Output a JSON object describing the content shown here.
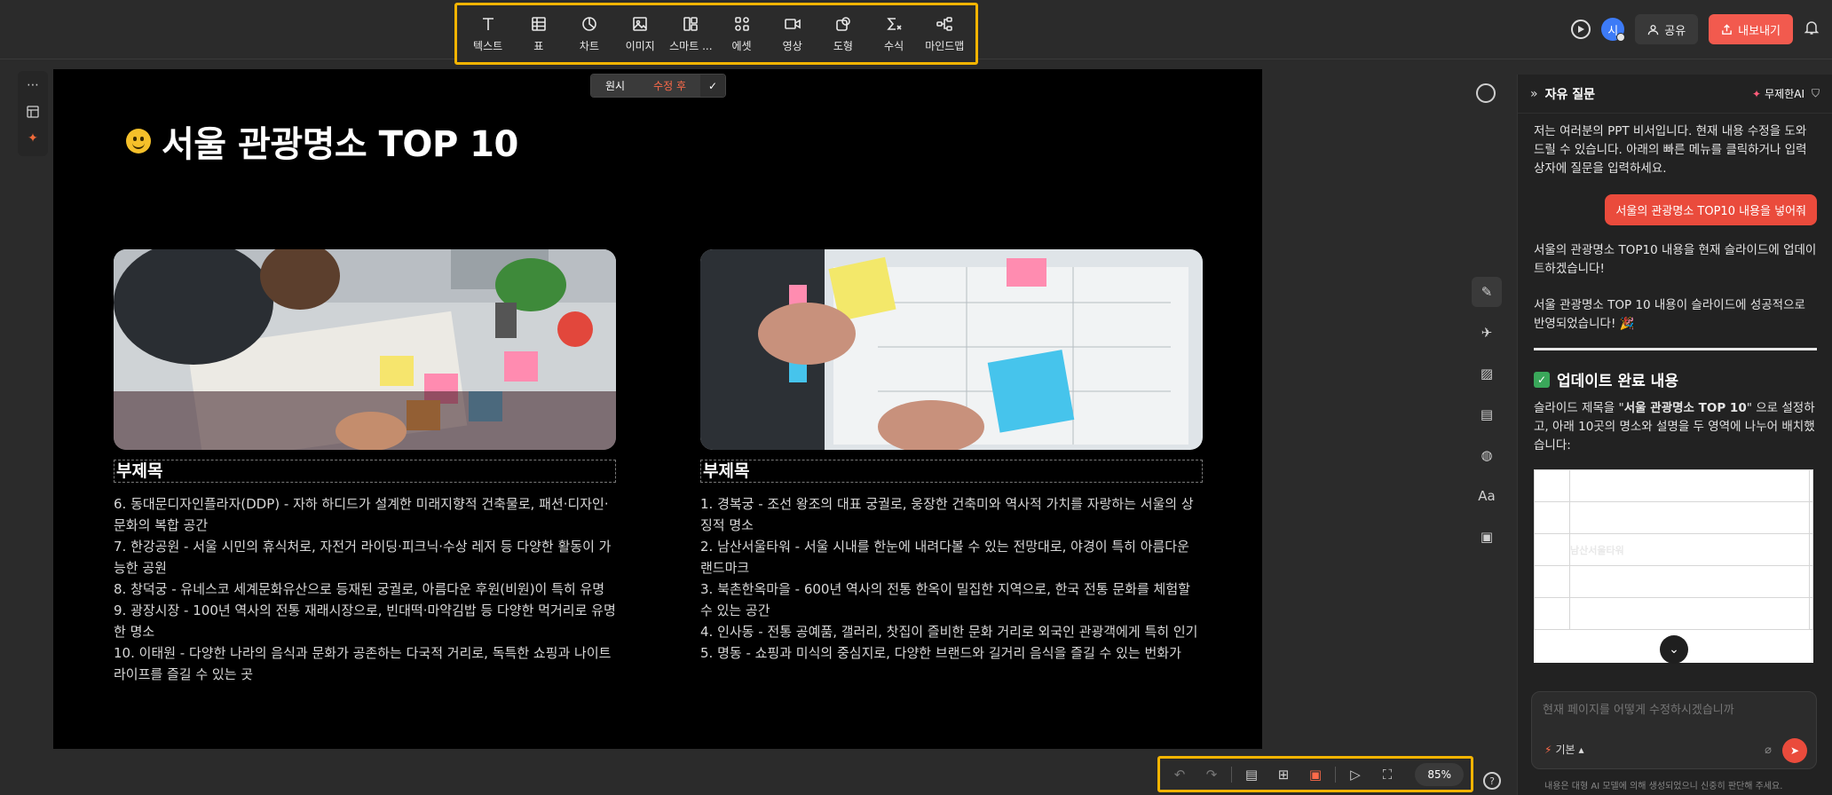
{
  "toolbar": {
    "items": [
      {
        "label": "텍스트",
        "icon": "text-icon"
      },
      {
        "label": "표",
        "icon": "table-icon"
      },
      {
        "label": "차트",
        "icon": "chart-icon"
      },
      {
        "label": "이미지",
        "icon": "image-icon"
      },
      {
        "label": "스마트 ...",
        "icon": "smart-icon"
      },
      {
        "label": "에셋",
        "icon": "asset-icon"
      },
      {
        "label": "영상",
        "icon": "video-icon"
      },
      {
        "label": "도형",
        "icon": "shape-icon"
      },
      {
        "label": "수식",
        "icon": "formula-icon"
      },
      {
        "label": "마인드맵",
        "icon": "mindmap-icon"
      }
    ]
  },
  "header": {
    "avatar_initial": "시",
    "share_label": "공유",
    "export_label": "내보내기"
  },
  "compare": {
    "original": "원시",
    "after": "수정 후",
    "confirm": "✓"
  },
  "slide": {
    "title": "서울 관광명소 TOP 10",
    "left": {
      "subtitle": "부제목",
      "items": [
        "6. 동대문디자인플라자(DDP) - 자하 하디드가 설계한 미래지향적 건축물로, 패션·디자인·문화의 복합 공간",
        "7. 한강공원 - 서울 시민의 휴식처로, 자전거 라이딩·피크닉·수상 레저 등 다양한 활동이 가능한 공원",
        "8. 창덕궁 - 유네스코 세계문화유산으로 등재된 궁궐로, 아름다운 후원(비원)이 특히 유명",
        "9. 광장시장 - 100년 역사의 전통 재래시장으로, 빈대떡·마약김밥 등 다양한 먹거리로 유명한 명소",
        "10. 이태원 - 다양한 나라의 음식과 문화가 공존하는 다국적 거리로, 독특한 쇼핑과 나이트라이프를 즐길 수 있는 곳"
      ]
    },
    "right": {
      "subtitle": "부제목",
      "items": [
        "1. 경복궁 - 조선 왕조의 대표 궁궐로, 웅장한 건축미와 역사적 가치를 자랑하는 서울의 상징적 명소",
        "2. 남산서울타워 - 서울 시내를 한눈에 내려다볼 수 있는 전망대로, 야경이 특히 아름다운 랜드마크",
        "3. 북촌한옥마을 - 600년 역사의 전통 한옥이 밀집한 지역으로, 한국 전통 문화를 체험할 수 있는 공간",
        "4. 인사동 - 전통 공예품, 갤러리, 찻집이 즐비한 문화 거리로 외국인 관광객에게 특히 인기",
        "5. 명동 - 쇼핑과 미식의 중심지로, 다양한 브랜드와 길거리 음식을 즐길 수 있는 번화가"
      ]
    }
  },
  "panel": {
    "title": "자유 질문",
    "unlimited": "무제한AI",
    "intro": "저는 여러분의 PPT 비서입니다. 현재 내용 수정을 도와드릴 수 있습니다. 아래의 빠른 메뉴를 클릭하거나 입력 상자에 질문을 입력하세요.",
    "user_message": "서울의 관광명소 TOP10 내용을 넣어줘",
    "reply_1": "서울의 관광명소 TOP10 내용을 현재 슬라이드에 업데이트하겠습니다!",
    "reply_2": "서울 관광명소 TOP 10 내용이 슬라이드에 성공적으로 반영되었습니다! 🎉",
    "update_title": "업데이트 완료 내용",
    "update_text_prefix": "슬라이드 제목을 \"",
    "update_text_bold": "서울 관광명소 TOP 10",
    "update_text_suffix": "\" 으로 설정하고, 아래 10곳의 명소와 설명을 두 영역에 나누어 배치했습니다:",
    "table_visible_cell": "남산서울타워",
    "input_placeholder": "현재 페이지를 어떻게 수정하시겠습니까",
    "mode_label": "기본",
    "disclaimer": "내용은 대형 AI 모델에 의해 생성되었으니 신중히 판단해 주세요."
  },
  "bottombar": {
    "zoom": "85%"
  }
}
